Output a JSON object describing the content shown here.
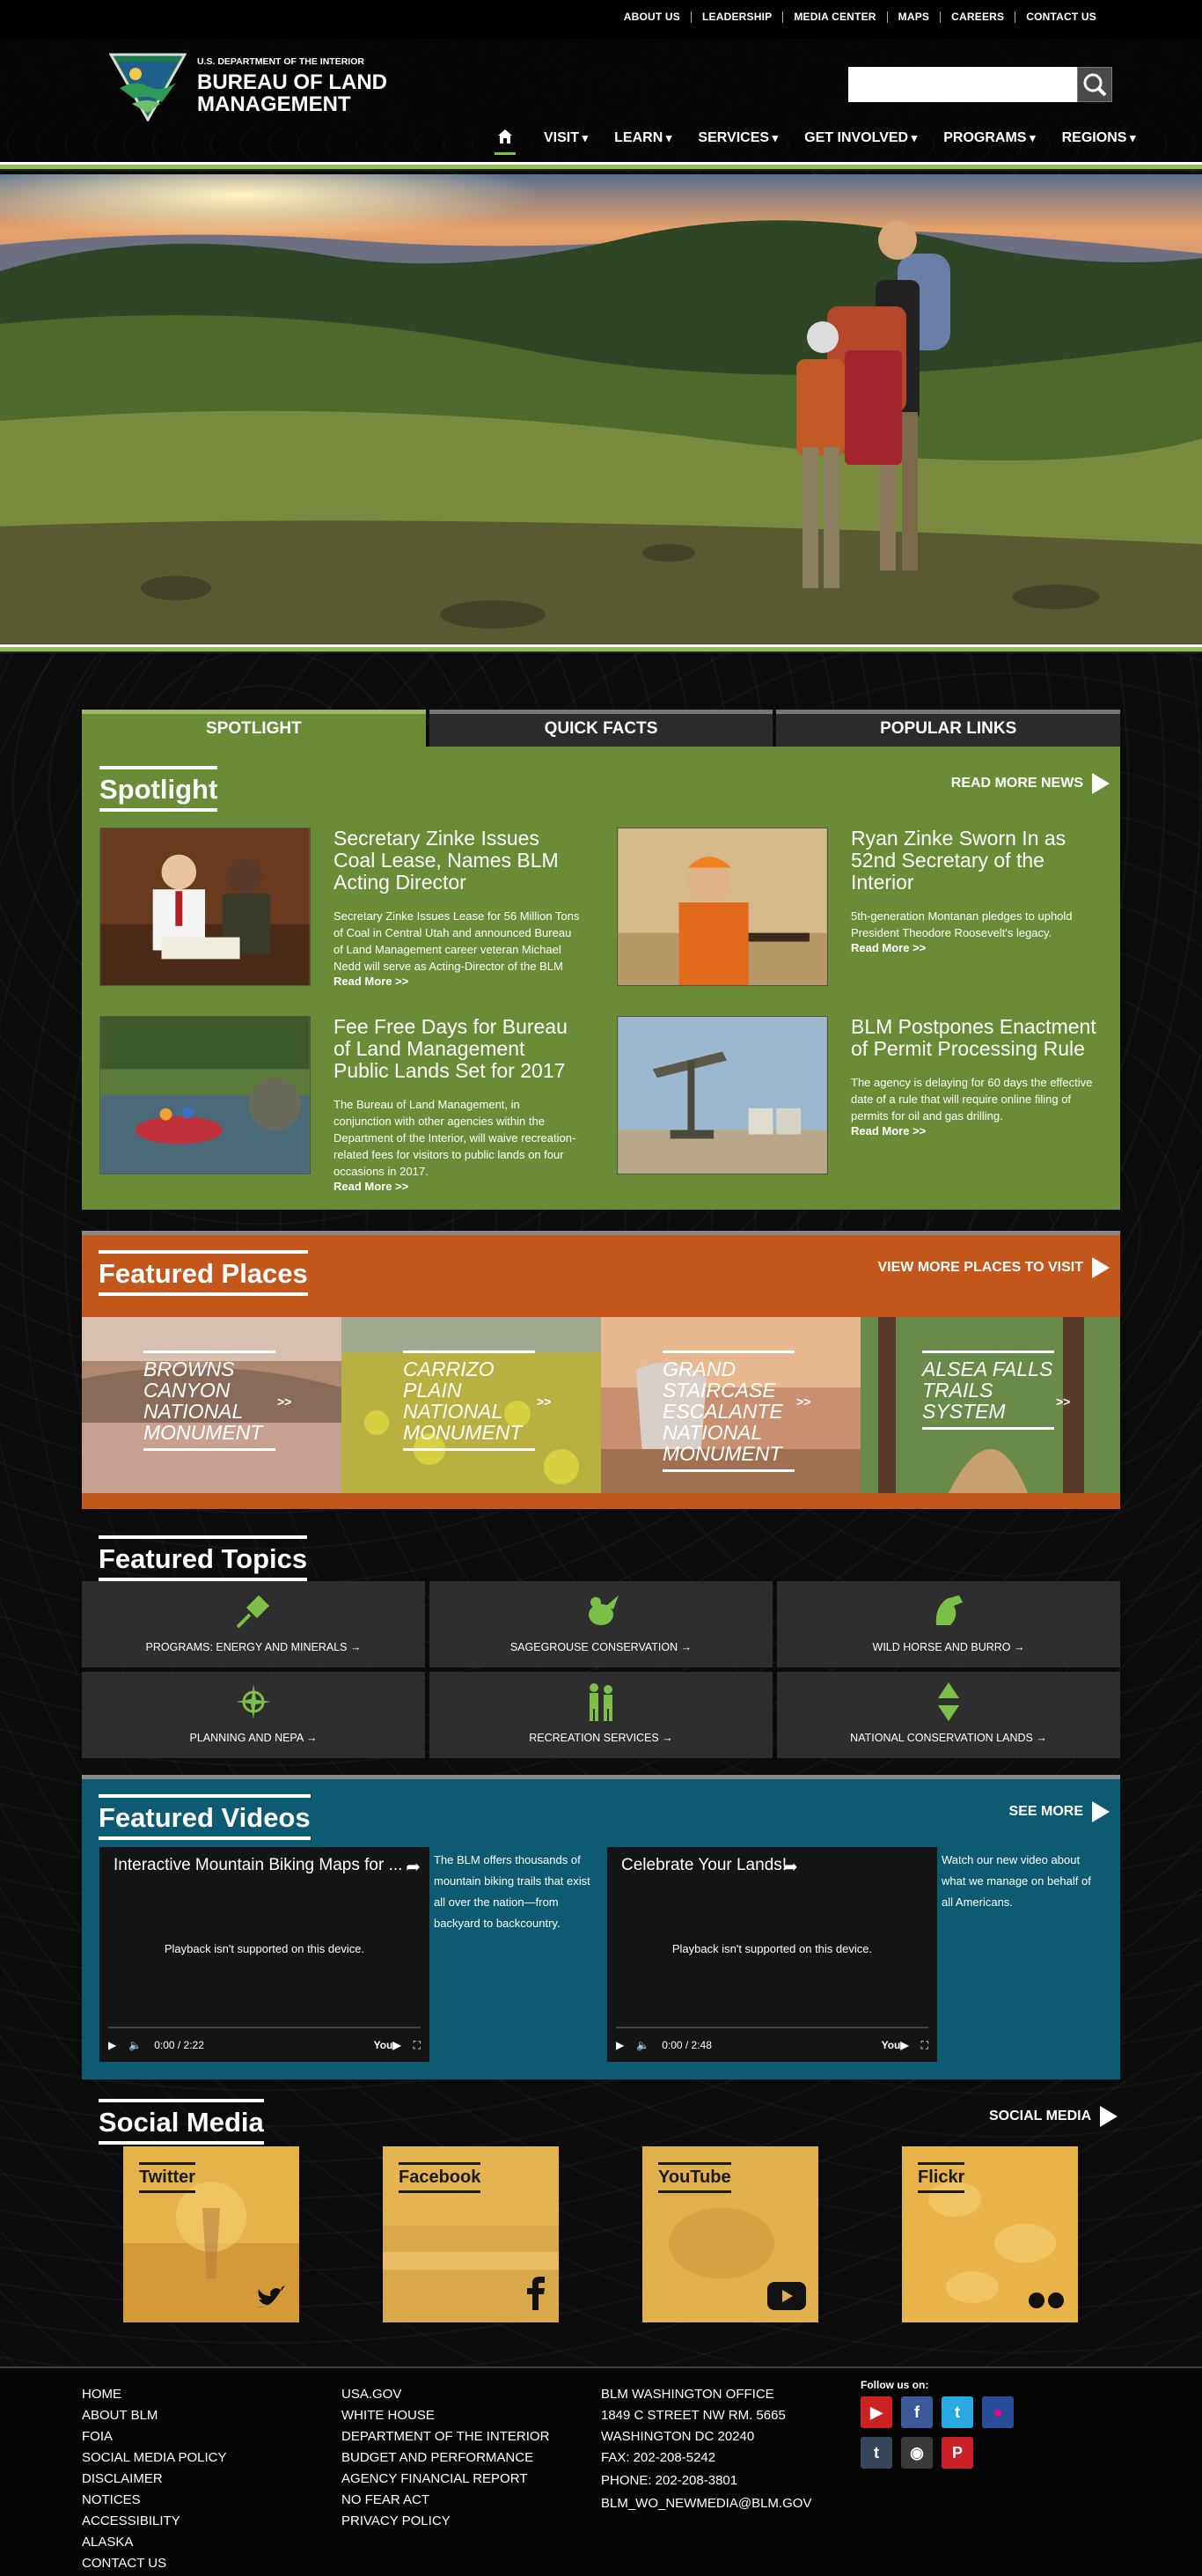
{
  "util_nav": [
    "ABOUT US",
    "LEADERSHIP",
    "MEDIA CENTER",
    "MAPS",
    "CAREERS",
    "CONTACT US"
  ],
  "header": {
    "agency_top": "U.S. DEPARTMENT OF THE INTERIOR",
    "agency_name": "BUREAU OF LAND MANAGEMENT",
    "search_placeholder": ""
  },
  "main_nav": [
    "VISIT",
    "LEARN",
    "SERVICES",
    "GET INVOLVED",
    "PROGRAMS",
    "REGIONS"
  ],
  "tabs": [
    "SPOTLIGHT",
    "QUICK FACTS",
    "POPULAR LINKS"
  ],
  "spotlight": {
    "title": "Spotlight",
    "read_more": "READ MORE NEWS",
    "items": [
      {
        "title": "Secretary Zinke Issues Coal Lease, Names BLM Acting Director",
        "body": "Secretary Zinke Issues Lease for 56 Million Tons of Coal in Central Utah and announced Bureau of Land Management career veteran Michael Nedd will serve as Acting-Director of the BLM",
        "link": "Read More >>"
      },
      {
        "title": "Ryan Zinke Sworn In as 52nd Secretary of the Interior",
        "body": "5th-generation Montanan pledges to uphold President Theodore Roosevelt's legacy.",
        "link": "Read More >>"
      },
      {
        "title": "Fee Free Days for Bureau of Land Management Public Lands Set for 2017",
        "body": "The Bureau of Land Management, in conjunction with other agencies within the Department of the Interior, will waive recreation-related fees for visitors to public lands on four occasions in 2017.",
        "link": "Read More >>"
      },
      {
        "title": "BLM Postpones Enactment of Permit Processing Rule",
        "body": "The agency is delaying for 60 days the effective date of a rule that will require online filing of permits for oil and gas drilling.",
        "link": "Read More >>"
      }
    ]
  },
  "places": {
    "title": "Featured Places",
    "more": "VIEW MORE PLACES TO VISIT",
    "items": [
      {
        "name": "Browns Canyon National Monument",
        "go": ">>"
      },
      {
        "name": "Carrizo Plain National Monument",
        "go": ">>"
      },
      {
        "name": "Grand Staircase Escalante National Monument",
        "go": ">>"
      },
      {
        "name": "Alsea Falls Trails System",
        "go": ">>"
      }
    ]
  },
  "topics": {
    "title": "Featured Topics",
    "items": [
      {
        "label": "PROGRAMS: ENERGY AND MINERALS →",
        "icon": "plug-icon"
      },
      {
        "label": "SAGEGROUSE CONSERVATION →",
        "icon": "sage-grouse-icon"
      },
      {
        "label": "WILD HORSE AND BURRO →",
        "icon": "horse-icon"
      },
      {
        "label": "PLANNING AND NEPA →",
        "icon": "compass-icon"
      },
      {
        "label": "RECREATION SERVICES →",
        "icon": "hikers-icon"
      },
      {
        "label": "NATIONAL CONSERVATION LANDS →",
        "icon": "arrows-icon"
      }
    ]
  },
  "videos": {
    "title": "Featured Videos",
    "more": "SEE MORE",
    "items": [
      {
        "title": "Interactive Mountain Biking Maps for ...",
        "playback": "Playback isn't supported on this device.",
        "time": "0:00 / 2:22",
        "desc": "The BLM offers thousands of mountain biking trails that exist all over the nation—from backyard to backcountry."
      },
      {
        "title": "Celebrate Your Lands!",
        "playback": "Playback isn't supported on this device.",
        "time": "0:00 / 2:48",
        "desc": "Watch our new video about what we manage on behalf of all Americans."
      }
    ]
  },
  "social": {
    "title": "Social Media",
    "more": "SOCIAL MEDIA",
    "items": [
      "Twitter",
      "Facebook",
      "YouTube",
      "Flickr"
    ]
  },
  "footer": {
    "col1": [
      "HOME",
      "ABOUT BLM",
      "FOIA",
      "SOCIAL MEDIA POLICY",
      "DISCLAIMER",
      "NOTICES",
      "ACCESSIBILITY",
      "ALASKA",
      "CONTACT US"
    ],
    "col2": [
      "USA.GOV",
      "WHITE HOUSE",
      "DEPARTMENT OF THE INTERIOR",
      "BUDGET AND PERFORMANCE",
      "AGENCY FINANCIAL REPORT",
      "NO FEAR ACT",
      "PRIVACY POLICY"
    ],
    "office": [
      "BLM WASHINGTON OFFICE",
      "1849 C STREET NW RM. 5665",
      "WASHINGTON DC 20240",
      "FAX: 202-208-5242"
    ],
    "phone": "PHONE: 202-208-3801",
    "email": "BLM_WO_NEWMEDIA@BLM.GOV",
    "follow": "Follow us on:"
  },
  "colors": {
    "green": "#6b8c36",
    "orange": "#c4571c",
    "teal": "#0d5b73",
    "accent": "#8cc152"
  }
}
